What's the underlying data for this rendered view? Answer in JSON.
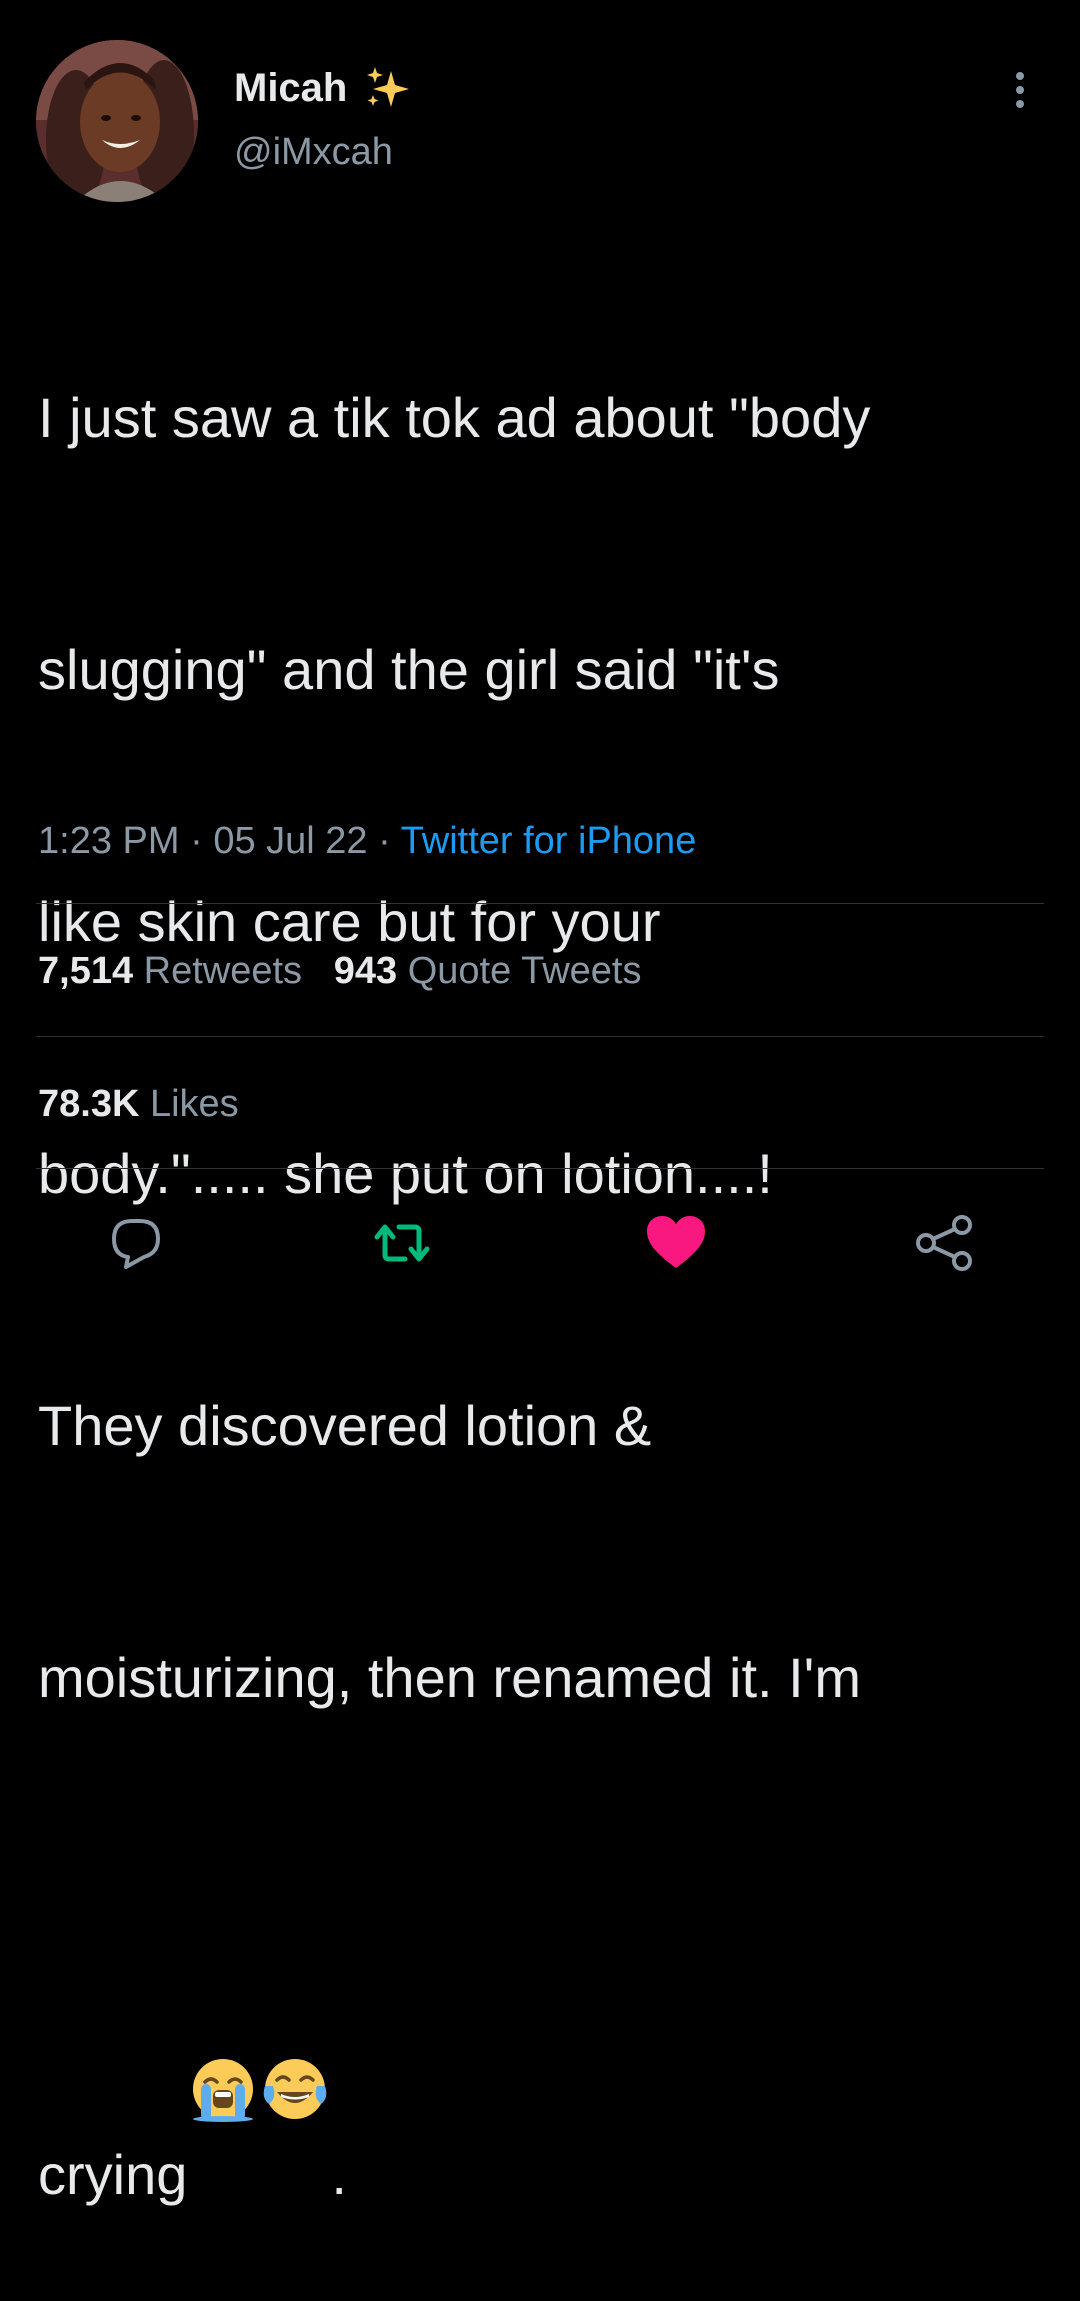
{
  "author": {
    "display_name": "Micah",
    "handle": "@iMxcah",
    "avatar_icon": "profile-photo",
    "badge_icon": "sparkles-emoji"
  },
  "tweet": {
    "lines": [
      "I just saw a tik tok ad about \"body",
      "slugging\" and the girl said \"it's",
      "like skin care but for your",
      "body.\"..... she put on lotion....!",
      "They discovered lotion &",
      "moisturizing, then renamed it. I'm",
      "crying"
    ],
    "trailing_text": ".",
    "emojis": [
      "loudly-crying-face-emoji",
      "face-with-tears-of-joy-emoji"
    ]
  },
  "meta": {
    "time": "1:23 PM",
    "separator": " · ",
    "date": "05 Jul 22",
    "source": "Twitter for iPhone"
  },
  "stats": {
    "retweets_count": "7,514",
    "retweets_label": "Retweets",
    "quotes_count": "943",
    "quotes_label": "Quote Tweets",
    "likes_count": "78.3K",
    "likes_label": "Likes"
  },
  "actions": {
    "reply_icon": "reply-icon",
    "retweet_icon": "retweet-icon",
    "like_icon": "heart-icon",
    "share_icon": "share-icon"
  },
  "colors": {
    "background": "#000000",
    "text_primary": "#e7e9ea",
    "text_secondary": "#8b98a5",
    "link": "#1d9bf0",
    "divider": "#2f3336",
    "retweet_active": "#00ba7c",
    "like_active": "#f91880"
  }
}
